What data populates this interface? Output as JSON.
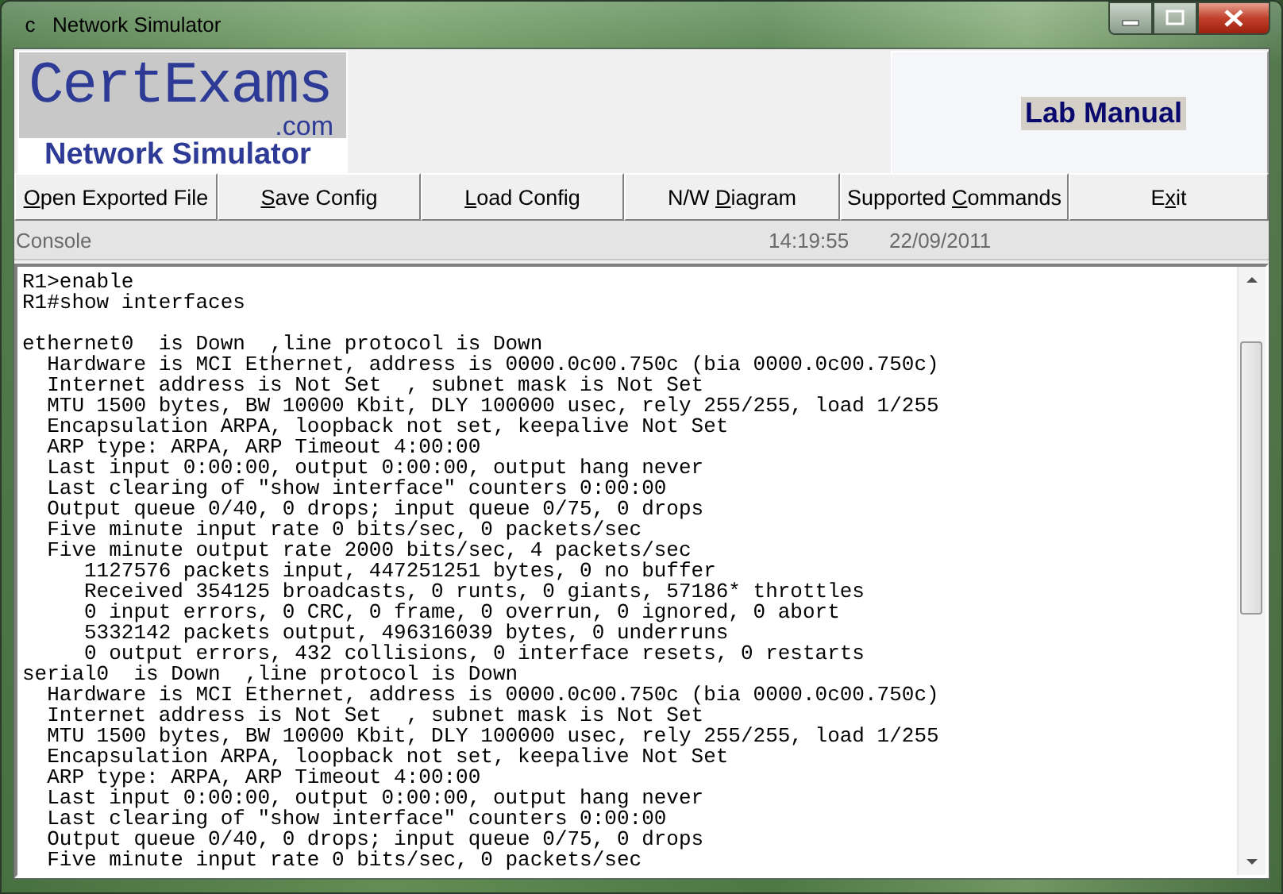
{
  "window": {
    "icon_text": "c",
    "title": "Network Simulator"
  },
  "logo": {
    "title": "CertExams",
    "domain": ".com",
    "subtitle": "Network Simulator"
  },
  "lab_manual": {
    "label": "Lab Manual"
  },
  "toolbar": [
    {
      "key": "O",
      "post": "pen Exported File"
    },
    {
      "key": "S",
      "post": "ave Config"
    },
    {
      "key": "L",
      "post": "oad Config"
    },
    {
      "pre": "N/W ",
      "key": "D",
      "post": "iagram"
    },
    {
      "pre": "Supported ",
      "key": "C",
      "post": "ommands"
    },
    {
      "pre": "E",
      "key": "x",
      "post": "it"
    }
  ],
  "console_bar": {
    "label": "Console",
    "time": "14:19:55",
    "date": "22/09/2011"
  },
  "console_commands": [
    "R1>enable",
    "R1#show interfaces"
  ],
  "console_output": [
    "ethernet0  is Down  ,line protocol is Down",
    "  Hardware is MCI Ethernet, address is 0000.0c00.750c (bia 0000.0c00.750c)",
    "  Internet address is Not Set  , subnet mask is Not Set",
    "  MTU 1500 bytes, BW 10000 Kbit, DLY 100000 usec, rely 255/255, load 1/255",
    "  Encapsulation ARPA, loopback not set, keepalive Not Set",
    "  ARP type: ARPA, ARP Timeout 4:00:00",
    "  Last input 0:00:00, output 0:00:00, output hang never",
    "  Last clearing of \"show interface\" counters 0:00:00",
    "  Output queue 0/40, 0 drops; input queue 0/75, 0 drops",
    "  Five minute input rate 0 bits/sec, 0 packets/sec",
    "  Five minute output rate 2000 bits/sec, 4 packets/sec",
    "     1127576 packets input, 447251251 bytes, 0 no buffer",
    "     Received 354125 broadcasts, 0 runts, 0 giants, 57186* throttles",
    "     0 input errors, 0 CRC, 0 frame, 0 overrun, 0 ignored, 0 abort",
    "     5332142 packets output, 496316039 bytes, 0 underruns",
    "     0 output errors, 432 collisions, 0 interface resets, 0 restarts",
    "serial0  is Down  ,line protocol is Down",
    "  Hardware is MCI Ethernet, address is 0000.0c00.750c (bia 0000.0c00.750c)",
    "  Internet address is Not Set  , subnet mask is Not Set",
    "  MTU 1500 bytes, BW 10000 Kbit, DLY 100000 usec, rely 255/255, load 1/255",
    "  Encapsulation ARPA, loopback not set, keepalive Not Set",
    "  ARP type: ARPA, ARP Timeout 4:00:00",
    "  Last input 0:00:00, output 0:00:00, output hang never",
    "  Last clearing of \"show interface\" counters 0:00:00",
    "  Output queue 0/40, 0 drops; input queue 0/75, 0 drops",
    "  Five minute input rate 0 bits/sec, 0 packets/sec"
  ]
}
